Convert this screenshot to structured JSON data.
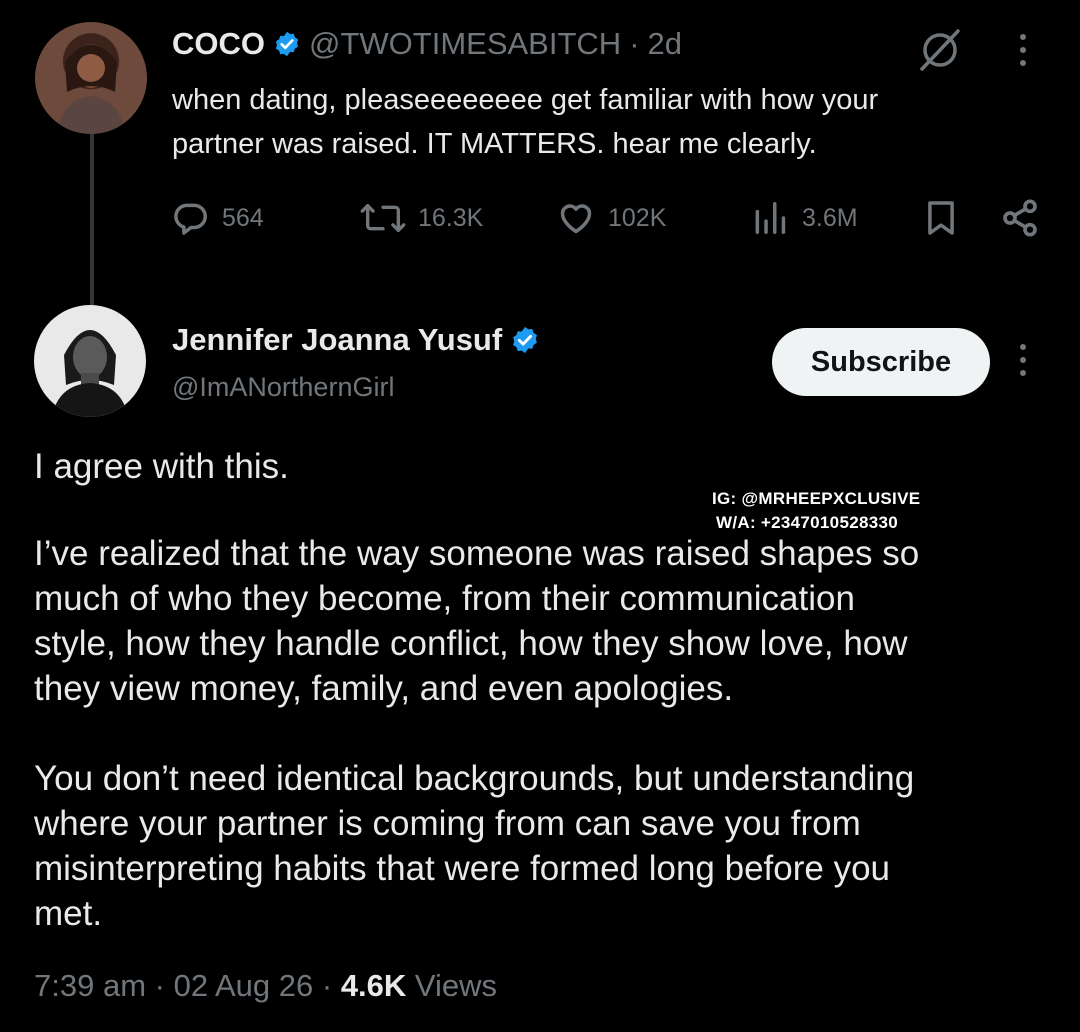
{
  "quoted_tweet": {
    "author_name": "COCO",
    "handle": "@TWOTIMESABITCH",
    "separator": "·",
    "time_ago": "2d",
    "text_line1": "when dating, pleaseeeeeeee get familiar with how your",
    "text_line2": "partner was raised. IT MATTERS. hear me clearly.",
    "actions": {
      "replies": "564",
      "reposts": "16.3K",
      "likes": "102K",
      "views": "3.6M"
    }
  },
  "reply": {
    "author_name": "Jennifer Joanna Yusuf",
    "handle": "@ImANorthernGirl",
    "subscribe_label": "Subscribe",
    "paragraph1": "I agree with this.",
    "paragraph2_lines": [
      "I’ve realized that the way someone was raised shapes so",
      "much of who they become, from their communication",
      "style, how they handle conflict, how they show love, how",
      "they view money, family, and even apologies."
    ],
    "paragraph3_lines": [
      "You don’t need identical backgrounds, but understanding",
      "where your partner is coming from can save you from",
      "misinterpreting habits that were formed long before you",
      "met."
    ],
    "meta": {
      "time": "7:39 am",
      "sep1": "·",
      "date": "02 Aug 26",
      "sep2": "·",
      "views_count": "4.6K",
      "views_label": "Views"
    }
  },
  "watermark": {
    "line1": "IG: @MRHEEPXCLUSIVE",
    "line2": "W/A: +2347010528330"
  },
  "colors": {
    "background": "#000000",
    "text": "#e7e9ea",
    "muted": "#71767b",
    "verified": "#1d9bf0",
    "subscribe_bg": "#eff3f4"
  }
}
